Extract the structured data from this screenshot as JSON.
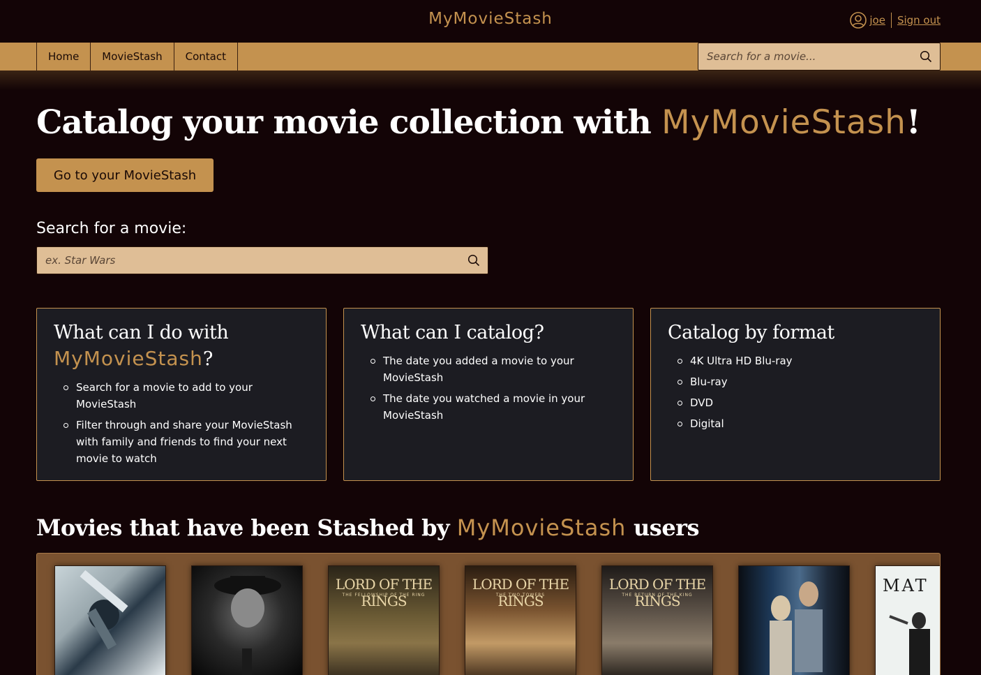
{
  "header": {
    "brand": "MyMovieStash",
    "username": "joe",
    "sign_out": "Sign out",
    "user_icon": "user-circle-icon"
  },
  "nav": {
    "items": [
      {
        "label": "Home"
      },
      {
        "label": "MovieStash"
      },
      {
        "label": "Contact"
      }
    ],
    "search_placeholder": "Search for a movie..."
  },
  "hero": {
    "title_prefix": "Catalog your movie collection with ",
    "title_accent": "MyMovieStash",
    "title_suffix": "!",
    "cta_label": "Go to your MovieStash"
  },
  "search": {
    "label": "Search for a movie:",
    "placeholder": "ex. Star Wars"
  },
  "cards": [
    {
      "title_prefix": "What can I do with ",
      "title_accent": "MyMovieStash",
      "title_suffix": "?",
      "items": [
        "Search for a movie to add to your MovieStash",
        "Filter through and share your MovieStash with family and friends to find your next movie to watch"
      ]
    },
    {
      "title": "What can I catalog?",
      "items": [
        "The date you added a movie to your MovieStash",
        "The date you watched a movie in your MovieStash"
      ]
    },
    {
      "title": "Catalog by format",
      "items": [
        "4K Ultra HD Blu-ray",
        "Blu-ray",
        "DVD",
        "Digital"
      ]
    }
  ],
  "stashed": {
    "title_prefix": "Movies that have been Stashed by ",
    "title_accent": "MyMovieStash",
    "title_suffix": " users",
    "posters": [
      {
        "text": "",
        "sub": ""
      },
      {
        "text": "",
        "sub": ""
      },
      {
        "text": "LORD OF THE RINGS",
        "sub": "THE FELLOWSHIP OF THE RING"
      },
      {
        "text": "LORD OF THE RINGS",
        "sub": "THE TWO TOWERS"
      },
      {
        "text": "LORD OF THE RINGS",
        "sub": "THE RETURN OF THE KING"
      },
      {
        "text": "",
        "sub": ""
      },
      {
        "text": "MAT",
        "sub": ""
      }
    ]
  },
  "colors": {
    "background": "#130406",
    "accent": "#c4924f",
    "card": "#1c1c22",
    "search_field": "#dfbe96"
  }
}
